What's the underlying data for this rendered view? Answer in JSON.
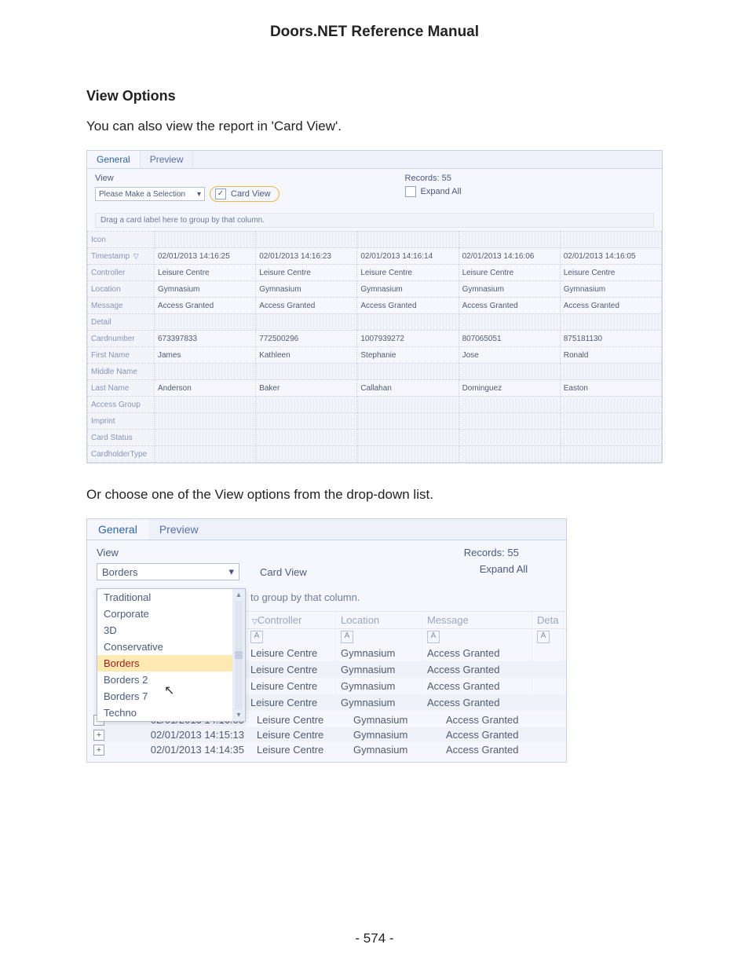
{
  "doc": {
    "manual_title": "Doors.NET Reference Manual",
    "section_title": "View Options",
    "intro_text": "You can also view the report in 'Card View'.",
    "mid_text": "Or choose one of the View options from the drop-down list.",
    "page_number": "- 574 -"
  },
  "ss1": {
    "tab_general": "General",
    "tab_preview": "Preview",
    "view_label": "View",
    "select_placeholder": "Please Make a Selection",
    "card_view_label": "Card View",
    "records_label": "Records: 55",
    "expand_all_label": "Expand All",
    "group_hint": "Drag a card label here to group by that column.",
    "row_labels": [
      "Icon",
      "Timestamp",
      "Controller",
      "Location",
      "Message",
      "Detail",
      "Cardnumber",
      "First Name",
      "Middle Name",
      "Last Name",
      "Access Group",
      "Imprint",
      "Card Status",
      "CardholderType"
    ],
    "cards": [
      {
        "Timestamp": "02/01/2013 14:16:25",
        "Controller": "Leisure Centre",
        "Location": "Gymnasium",
        "Message": "Access Granted",
        "Cardnumber": "673397833",
        "First Name": "James",
        "Last Name": "Anderson"
      },
      {
        "Timestamp": "02/01/2013 14:16:23",
        "Controller": "Leisure Centre",
        "Location": "Gymnasium",
        "Message": "Access Granted",
        "Cardnumber": "772500296",
        "First Name": "Kathleen",
        "Last Name": "Baker"
      },
      {
        "Timestamp": "02/01/2013 14:16:14",
        "Controller": "Leisure Centre",
        "Location": "Gymnasium",
        "Message": "Access Granted",
        "Cardnumber": "1007939272",
        "First Name": "Stephanie",
        "Last Name": "Callahan"
      },
      {
        "Timestamp": "02/01/2013 14:16:06",
        "Controller": "Leisure Centre",
        "Location": "Gymnasium",
        "Message": "Access Granted",
        "Cardnumber": "807065051",
        "First Name": "Jose",
        "Last Name": "Dominguez"
      },
      {
        "Timestamp": "02/01/2013 14:16:05",
        "Controller": "Leisure Centre",
        "Location": "Gymnasium",
        "Message": "Access Granted",
        "Cardnumber": "875181130",
        "First Name": "Ronald",
        "Last Name": "Easton"
      }
    ]
  },
  "ss2": {
    "tab_general": "General",
    "tab_preview": "Preview",
    "view_label": "View",
    "select_value": "Borders",
    "card_view_label": "Card View",
    "records_label": "Records: 55",
    "expand_all_label": "Expand All",
    "group_hint_suffix": "to group by that column.",
    "dropdown_options": [
      "Traditional",
      "Corporate",
      "3D",
      "Conservative",
      "Borders",
      "Borders 2",
      "Borders 7",
      "Techno"
    ],
    "dropdown_selected_index": 4,
    "grid_columns": [
      "Controller",
      "Location",
      "Message",
      "Deta"
    ],
    "grid_rows": [
      {
        "Controller": "Leisure Centre",
        "Location": "Gymnasium",
        "Message": "Access Granted",
        "alt": false
      },
      {
        "Controller": "Leisure Centre",
        "Location": "Gymnasium",
        "Message": "Access Granted",
        "alt": true
      },
      {
        "Controller": "Leisure Centre",
        "Location": "Gymnasium",
        "Message": "Access Granted",
        "alt": false
      },
      {
        "Controller": "Leisure Centre",
        "Location": "Gymnasium",
        "Message": "Access Granted",
        "alt": true
      }
    ],
    "bottom_rows": [
      {
        "Timestamp": "02/01/2013 14:16:05",
        "Controller": "Leisure Centre",
        "Location": "Gymnasium",
        "Message": "Access Granted",
        "alt": false
      },
      {
        "Timestamp": "02/01/2013 14:15:13",
        "Controller": "Leisure Centre",
        "Location": "Gymnasium",
        "Message": "Access Granted",
        "alt": true
      },
      {
        "Timestamp": "02/01/2013 14:14:35",
        "Controller": "Leisure Centre",
        "Location": "Gymnasium",
        "Message": "Access Granted",
        "alt": false
      }
    ]
  },
  "glyphs": {
    "check": "✓",
    "down": "▾",
    "up": "▴",
    "sort": "▽",
    "plus": "+",
    "cursor": "↖",
    "A": "A"
  }
}
